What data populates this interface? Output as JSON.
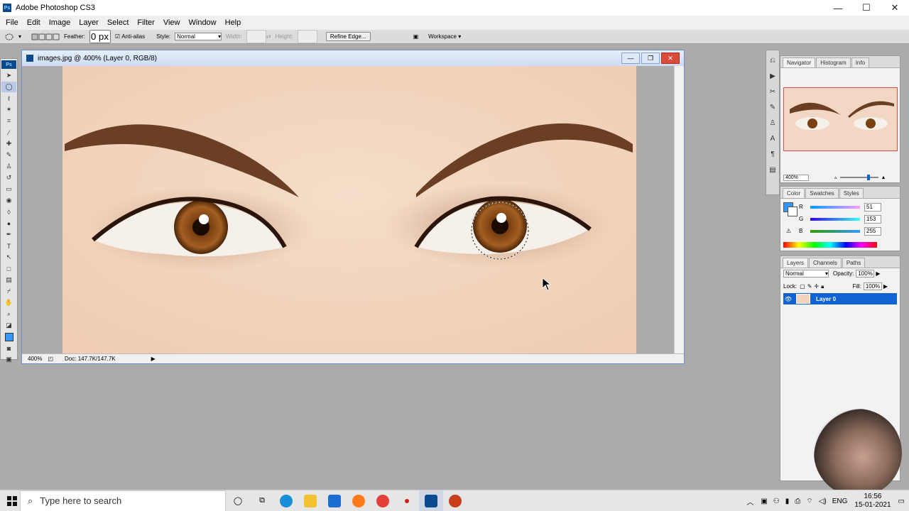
{
  "titlebar": {
    "title": "Adobe Photoshop CS3",
    "logo": "Ps",
    "minimize": "—",
    "maximize": "☐",
    "close": "✕"
  },
  "menu": [
    "File",
    "Edit",
    "Image",
    "Layer",
    "Select",
    "Filter",
    "View",
    "Window",
    "Help"
  ],
  "options": {
    "feather_label": "Feather:",
    "feather_value": "0 px",
    "antialias_label": "Anti-alias",
    "style_label": "Style:",
    "style_value": "Normal",
    "width_label": "Width:",
    "height_label": "Height:",
    "refine_edge": "Refine Edge...",
    "workspace": "Workspace ▾"
  },
  "tools_badge": "Ps",
  "document": {
    "title": "images.jpg @ 400% (Layer 0, RGB/8)",
    "zoom": "400%",
    "doc_size": "Doc: 147.7K/147.7K"
  },
  "navigator": {
    "tabs": [
      "Navigator",
      "Histogram",
      "Info"
    ],
    "zoom": "400%"
  },
  "color": {
    "tabs": [
      "Color",
      "Swatches",
      "Styles"
    ],
    "r_label": "R",
    "g_label": "G",
    "b_label": "B",
    "r": "51",
    "g": "153",
    "b": "255",
    "foreground_color": "#3399ff"
  },
  "layers": {
    "tabs": [
      "Layers",
      "Channels",
      "Paths"
    ],
    "blend_mode": "Normal",
    "opacity_label": "Opacity:",
    "opacity": "100%",
    "lock_label": "Lock:",
    "fill_label": "Fill:",
    "fill": "100%",
    "layer_name": "Layer 0"
  },
  "taskbar": {
    "search_placeholder": "Type here to search",
    "language": "ENG",
    "time": "16:56",
    "date": "15-01-2021"
  }
}
